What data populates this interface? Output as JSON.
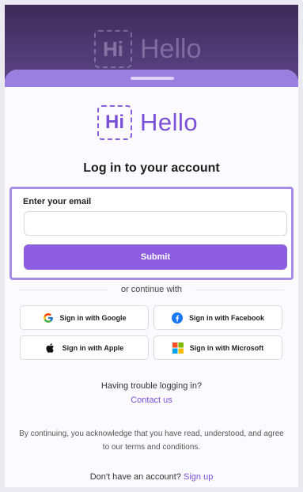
{
  "brand": {
    "hi": "Hi",
    "hello": "Hello"
  },
  "title": "Log in to your account",
  "email": {
    "label": "Enter your email",
    "value": "",
    "placeholder": ""
  },
  "submit_label": "Submit",
  "divider_text": "or continue with",
  "social": {
    "google": "Sign in with Google",
    "facebook": "Sign in with Facebook",
    "apple": "Sign in with Apple",
    "microsoft": "Sign in with Microsoft"
  },
  "help": {
    "trouble": "Having trouble logging in?",
    "contact": "Contact us"
  },
  "legal": "By continuing, you acknowledge that you have read, understood, and agree to our terms and conditions.",
  "signup": {
    "prompt": "Don't have an account?",
    "link": "Sign up"
  },
  "colors": {
    "accent": "#8d5fe0",
    "brand_text": "#7b4fd6",
    "backdrop": "#4f3a72",
    "highlight_border": "#a98be8"
  }
}
